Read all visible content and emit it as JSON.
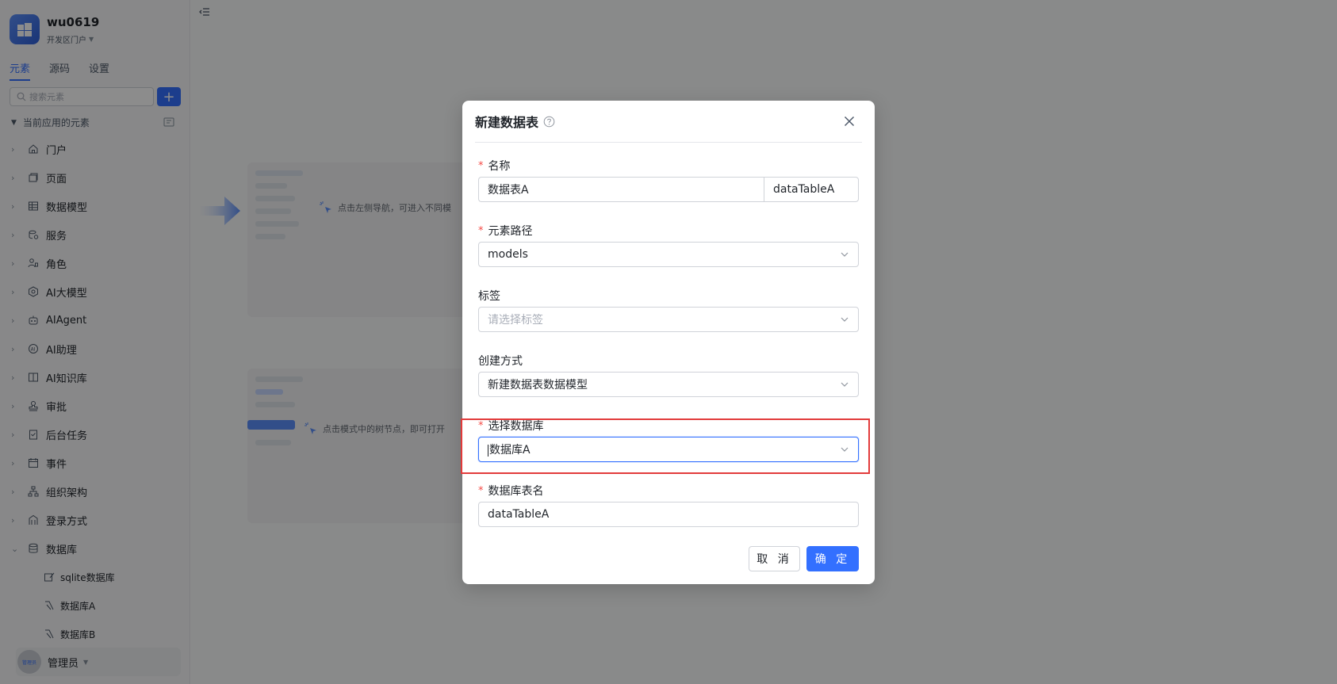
{
  "app": {
    "name": "wu0619",
    "portal": "开发区门户"
  },
  "sidebar": {
    "tabs": [
      {
        "label": "元素",
        "active": true
      },
      {
        "label": "源码",
        "active": false
      },
      {
        "label": "设置",
        "active": false
      }
    ],
    "search_placeholder": "搜索元素",
    "section_title": "当前应用的元素",
    "items": [
      {
        "label": "门户",
        "icon": "home-icon"
      },
      {
        "label": "页面",
        "icon": "pages-icon"
      },
      {
        "label": "数据模型",
        "icon": "table-icon"
      },
      {
        "label": "服务",
        "icon": "service-icon"
      },
      {
        "label": "角色",
        "icon": "role-icon"
      },
      {
        "label": "AI大模型",
        "icon": "ai-model-icon"
      },
      {
        "label": "AIAgent",
        "icon": "robot-icon"
      },
      {
        "label": "AI助理",
        "icon": "ai-assistant-icon"
      },
      {
        "label": "AI知识库",
        "icon": "book-icon"
      },
      {
        "label": "审批",
        "icon": "stamp-icon"
      },
      {
        "label": "后台任务",
        "icon": "task-icon"
      },
      {
        "label": "事件",
        "icon": "event-icon"
      },
      {
        "label": "组织架构",
        "icon": "org-icon"
      },
      {
        "label": "登录方式",
        "icon": "login-icon"
      },
      {
        "label": "数据库",
        "icon": "database-icon",
        "expanded": true
      }
    ],
    "sub_items": [
      {
        "label": "sqlite数据库",
        "icon": "edit-db-icon"
      },
      {
        "label": "数据库A",
        "icon": "db-link-icon"
      },
      {
        "label": "数据库B",
        "icon": "db-link-icon"
      }
    ],
    "user": {
      "name": "管理员",
      "avatar_text": "管理员"
    }
  },
  "main": {
    "guide1": "点击左侧导航，可进入不同模",
    "guide2": "点击模式中的树节点，即可打开"
  },
  "modal": {
    "title": "新建数据表",
    "fields": {
      "name": {
        "label": "名称",
        "value": "数据表A",
        "code": "dataTableA"
      },
      "path": {
        "label": "元素路径",
        "value": "models"
      },
      "tags": {
        "label": "标签",
        "placeholder": "请选择标签"
      },
      "method": {
        "label": "创建方式",
        "value": "新建数据表数据模型"
      },
      "database": {
        "label": "选择数据库",
        "value": "数据库A"
      },
      "table_name": {
        "label": "数据库表名",
        "value": "dataTableA"
      }
    },
    "cancel_label": "取 消",
    "ok_label": "确 定"
  },
  "colors": {
    "primary": "#3370ff",
    "required": "#f54a45",
    "highlight": "#e23b3b"
  }
}
